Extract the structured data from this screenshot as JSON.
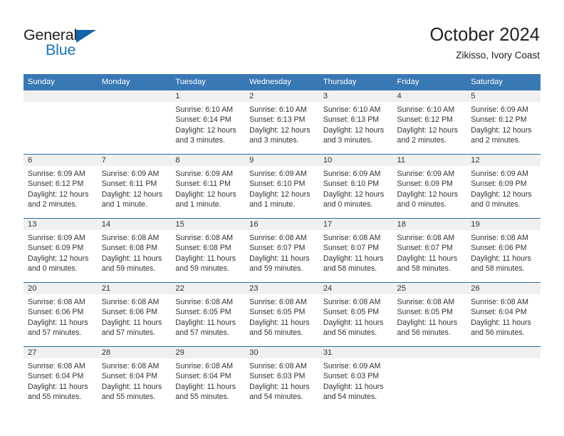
{
  "brand": {
    "name_line1": "General",
    "name_line2": "Blue",
    "color_dark": "#231f20",
    "color_blue": "#1a74bd"
  },
  "header": {
    "title": "October 2024",
    "subtitle": "Zikisso, Ivory Coast"
  },
  "theme": {
    "header_row_bg": "#3878b4",
    "row_separator": "#2d6ea8",
    "daynum_band_bg": "#f0f0f0",
    "text": "#333333"
  },
  "weekdays": [
    "Sunday",
    "Monday",
    "Tuesday",
    "Wednesday",
    "Thursday",
    "Friday",
    "Saturday"
  ],
  "weeks": [
    [
      {
        "day": "",
        "sunrise": "",
        "sunset": "",
        "daylight": "",
        "empty": true
      },
      {
        "day": "",
        "sunrise": "",
        "sunset": "",
        "daylight": "",
        "empty": true
      },
      {
        "day": "1",
        "sunrise": "Sunrise: 6:10 AM",
        "sunset": "Sunset: 6:14 PM",
        "daylight": "Daylight: 12 hours and 3 minutes."
      },
      {
        "day": "2",
        "sunrise": "Sunrise: 6:10 AM",
        "sunset": "Sunset: 6:13 PM",
        "daylight": "Daylight: 12 hours and 3 minutes."
      },
      {
        "day": "3",
        "sunrise": "Sunrise: 6:10 AM",
        "sunset": "Sunset: 6:13 PM",
        "daylight": "Daylight: 12 hours and 3 minutes."
      },
      {
        "day": "4",
        "sunrise": "Sunrise: 6:10 AM",
        "sunset": "Sunset: 6:12 PM",
        "daylight": "Daylight: 12 hours and 2 minutes."
      },
      {
        "day": "5",
        "sunrise": "Sunrise: 6:09 AM",
        "sunset": "Sunset: 6:12 PM",
        "daylight": "Daylight: 12 hours and 2 minutes."
      }
    ],
    [
      {
        "day": "6",
        "sunrise": "Sunrise: 6:09 AM",
        "sunset": "Sunset: 6:12 PM",
        "daylight": "Daylight: 12 hours and 2 minutes."
      },
      {
        "day": "7",
        "sunrise": "Sunrise: 6:09 AM",
        "sunset": "Sunset: 6:11 PM",
        "daylight": "Daylight: 12 hours and 1 minute."
      },
      {
        "day": "8",
        "sunrise": "Sunrise: 6:09 AM",
        "sunset": "Sunset: 6:11 PM",
        "daylight": "Daylight: 12 hours and 1 minute."
      },
      {
        "day": "9",
        "sunrise": "Sunrise: 6:09 AM",
        "sunset": "Sunset: 6:10 PM",
        "daylight": "Daylight: 12 hours and 1 minute."
      },
      {
        "day": "10",
        "sunrise": "Sunrise: 6:09 AM",
        "sunset": "Sunset: 6:10 PM",
        "daylight": "Daylight: 12 hours and 0 minutes."
      },
      {
        "day": "11",
        "sunrise": "Sunrise: 6:09 AM",
        "sunset": "Sunset: 6:09 PM",
        "daylight": "Daylight: 12 hours and 0 minutes."
      },
      {
        "day": "12",
        "sunrise": "Sunrise: 6:09 AM",
        "sunset": "Sunset: 6:09 PM",
        "daylight": "Daylight: 12 hours and 0 minutes."
      }
    ],
    [
      {
        "day": "13",
        "sunrise": "Sunrise: 6:09 AM",
        "sunset": "Sunset: 6:09 PM",
        "daylight": "Daylight: 12 hours and 0 minutes."
      },
      {
        "day": "14",
        "sunrise": "Sunrise: 6:08 AM",
        "sunset": "Sunset: 6:08 PM",
        "daylight": "Daylight: 11 hours and 59 minutes."
      },
      {
        "day": "15",
        "sunrise": "Sunrise: 6:08 AM",
        "sunset": "Sunset: 6:08 PM",
        "daylight": "Daylight: 11 hours and 59 minutes."
      },
      {
        "day": "16",
        "sunrise": "Sunrise: 6:08 AM",
        "sunset": "Sunset: 6:07 PM",
        "daylight": "Daylight: 11 hours and 59 minutes."
      },
      {
        "day": "17",
        "sunrise": "Sunrise: 6:08 AM",
        "sunset": "Sunset: 6:07 PM",
        "daylight": "Daylight: 11 hours and 58 minutes."
      },
      {
        "day": "18",
        "sunrise": "Sunrise: 6:08 AM",
        "sunset": "Sunset: 6:07 PM",
        "daylight": "Daylight: 11 hours and 58 minutes."
      },
      {
        "day": "19",
        "sunrise": "Sunrise: 6:08 AM",
        "sunset": "Sunset: 6:06 PM",
        "daylight": "Daylight: 11 hours and 58 minutes."
      }
    ],
    [
      {
        "day": "20",
        "sunrise": "Sunrise: 6:08 AM",
        "sunset": "Sunset: 6:06 PM",
        "daylight": "Daylight: 11 hours and 57 minutes."
      },
      {
        "day": "21",
        "sunrise": "Sunrise: 6:08 AM",
        "sunset": "Sunset: 6:06 PM",
        "daylight": "Daylight: 11 hours and 57 minutes."
      },
      {
        "day": "22",
        "sunrise": "Sunrise: 6:08 AM",
        "sunset": "Sunset: 6:05 PM",
        "daylight": "Daylight: 11 hours and 57 minutes."
      },
      {
        "day": "23",
        "sunrise": "Sunrise: 6:08 AM",
        "sunset": "Sunset: 6:05 PM",
        "daylight": "Daylight: 11 hours and 56 minutes."
      },
      {
        "day": "24",
        "sunrise": "Sunrise: 6:08 AM",
        "sunset": "Sunset: 6:05 PM",
        "daylight": "Daylight: 11 hours and 56 minutes."
      },
      {
        "day": "25",
        "sunrise": "Sunrise: 6:08 AM",
        "sunset": "Sunset: 6:05 PM",
        "daylight": "Daylight: 11 hours and 56 minutes."
      },
      {
        "day": "26",
        "sunrise": "Sunrise: 6:08 AM",
        "sunset": "Sunset: 6:04 PM",
        "daylight": "Daylight: 11 hours and 56 minutes."
      }
    ],
    [
      {
        "day": "27",
        "sunrise": "Sunrise: 6:08 AM",
        "sunset": "Sunset: 6:04 PM",
        "daylight": "Daylight: 11 hours and 55 minutes."
      },
      {
        "day": "28",
        "sunrise": "Sunrise: 6:08 AM",
        "sunset": "Sunset: 6:04 PM",
        "daylight": "Daylight: 11 hours and 55 minutes."
      },
      {
        "day": "29",
        "sunrise": "Sunrise: 6:08 AM",
        "sunset": "Sunset: 6:04 PM",
        "daylight": "Daylight: 11 hours and 55 minutes."
      },
      {
        "day": "30",
        "sunrise": "Sunrise: 6:08 AM",
        "sunset": "Sunset: 6:03 PM",
        "daylight": "Daylight: 11 hours and 54 minutes."
      },
      {
        "day": "31",
        "sunrise": "Sunrise: 6:09 AM",
        "sunset": "Sunset: 6:03 PM",
        "daylight": "Daylight: 11 hours and 54 minutes."
      },
      {
        "day": "",
        "sunrise": "",
        "sunset": "",
        "daylight": "",
        "empty": true
      },
      {
        "day": "",
        "sunrise": "",
        "sunset": "",
        "daylight": "",
        "empty": true
      }
    ]
  ]
}
